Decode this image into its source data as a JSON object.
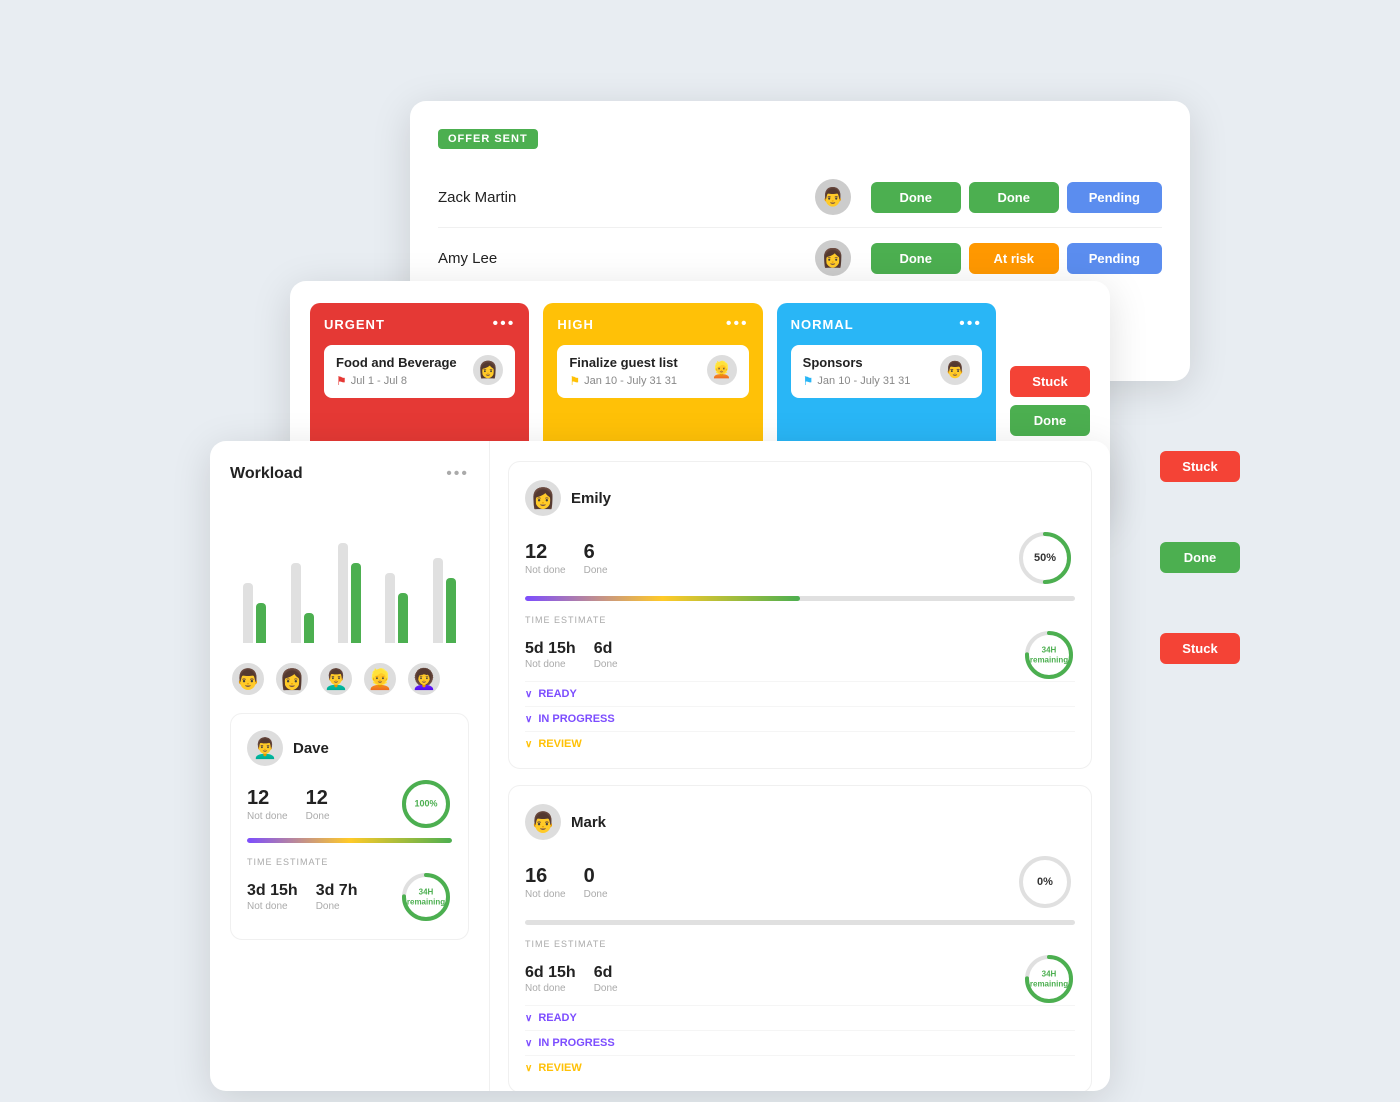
{
  "back_card": {
    "badge": "OFFER SENT",
    "rows": [
      {
        "name": "Zack Martin",
        "avatar": "👨",
        "statuses": [
          "Done",
          "Done",
          "Pending"
        ]
      },
      {
        "name": "Amy Lee",
        "avatar": "👩",
        "statuses": [
          "Done",
          "At risk",
          "Pending"
        ]
      }
    ]
  },
  "kanban": {
    "columns": [
      {
        "id": "urgent",
        "label": "URGENT",
        "color": "urgent",
        "task_title": "Food and Beverage",
        "task_avatar": "👩",
        "task_date": "Jul 1 - Jul 8",
        "flag_color": "red"
      },
      {
        "id": "high",
        "label": "HIGH",
        "color": "high",
        "task_title": "Finalize guest list",
        "task_avatar": "👱",
        "task_date": "Jan 10 - July 31 31",
        "flag_color": "yellow"
      },
      {
        "id": "normal",
        "label": "NORMAL",
        "color": "normal",
        "task_title": "Sponsors",
        "task_avatar": "👨",
        "task_date": "Jan 10 - July 31 31",
        "flag_color": "blue"
      }
    ],
    "side_statuses": [
      "Stuck",
      "Done"
    ]
  },
  "workload": {
    "title": "Workload",
    "bars": [
      {
        "gray": 60,
        "green": 40
      },
      {
        "gray": 90,
        "green": 30
      },
      {
        "gray": 100,
        "green": 80
      },
      {
        "gray": 70,
        "green": 50
      },
      {
        "gray": 85,
        "green": 65
      }
    ],
    "avatars": [
      "👨",
      "👩",
      "👨‍🦱",
      "👱",
      "👩‍🦱"
    ]
  },
  "dave": {
    "name": "Dave",
    "avatar": "👨‍🦱",
    "not_done": "12",
    "done": "12",
    "not_done_label": "Not done",
    "done_label": "Done",
    "circle_pct": 100,
    "circle_label": "100%",
    "time_est_label": "TIME ESTIMATE",
    "time_not_done": "3d 15h",
    "time_done": "3d 7h",
    "time_not_done_label": "Not done",
    "time_done_label": "Done",
    "remaining": "34H",
    "remaining_sub": "remaining"
  },
  "emily": {
    "name": "Emily",
    "avatar": "👩",
    "not_done": "12",
    "done": "6",
    "not_done_label": "Not done",
    "done_label": "Done",
    "pct": "50%",
    "time_est_label": "TIME ESTIMATE",
    "time_not_done": "5d 15h",
    "time_done": "6d",
    "time_not_done_label": "Not done",
    "time_done_label": "Done",
    "remaining": "34H",
    "remaining_sub": "remaining",
    "sections": [
      {
        "label": "READY",
        "color": "purple"
      },
      {
        "label": "IN PROGRESS",
        "color": "purple"
      },
      {
        "label": "REVIEW",
        "color": "yellow"
      }
    ]
  },
  "mark": {
    "name": "Mark",
    "avatar": "👨",
    "not_done": "16",
    "done": "0",
    "not_done_label": "Not done",
    "done_label": "Done",
    "pct": "0%",
    "time_est_label": "TIME ESTIMATE",
    "time_not_done": "6d 15h",
    "time_done": "6d",
    "time_not_done_label": "Not done",
    "time_done_label": "Done",
    "remaining": "34H",
    "remaining_sub": "remaining",
    "sections": [
      {
        "label": "READY",
        "color": "purple"
      },
      {
        "label": "IN PROGRESS",
        "color": "purple"
      },
      {
        "label": "REVIEW",
        "color": "yellow"
      }
    ]
  }
}
